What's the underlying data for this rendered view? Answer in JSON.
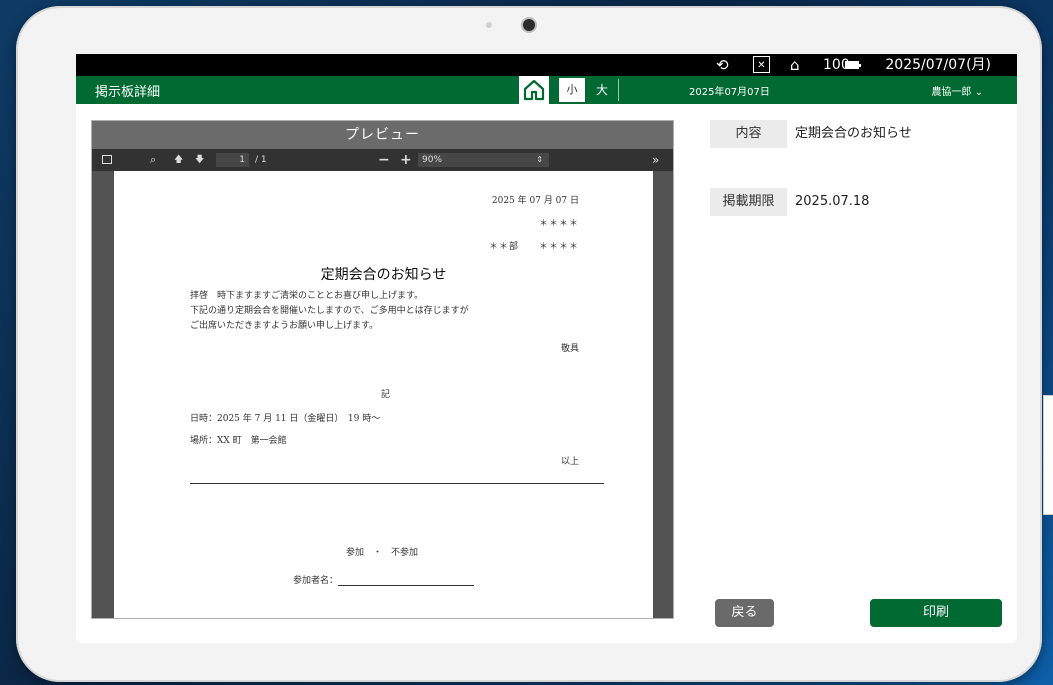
{
  "status_bar": {
    "rotate_icon": "screen-rotation-icon",
    "expand_icon": "expand-icon",
    "home_icon": "home-outline-icon",
    "battery_text": "100",
    "date": "2025/07/07(月)"
  },
  "app_bar": {
    "title": "掲示板詳細",
    "home_icon": "home-icon",
    "font_small": "小",
    "font_large": "大",
    "date": "2025年07月07日",
    "user": "農協一郎 ⌄"
  },
  "preview": {
    "title": "プレビュー",
    "toolbar": {
      "page_current": "1",
      "page_total": "/ 1",
      "zoom": "90%"
    },
    "document": {
      "date": "2025 年 07 月 07 日",
      "sender_name": "＊＊＊＊",
      "department": "＊＊部　　＊＊＊＊",
      "title": "定期会合のお知らせ",
      "body_lines": [
        "拝啓　時下ますますご清栄のこととお喜び申し上げます。",
        "下記の通り定期会合を開催いたしますので、ご多用中とは存じますが",
        "ご出席いただきますようお願い申し上げます。"
      ],
      "closing": "敬具",
      "ki": "記",
      "datetime": "日時：2025 年 7 月 11 日（金曜日）　19 時～",
      "place": "場所：XX 町　第一会館",
      "ijou": "以上",
      "attendance": "参加　・　不参加",
      "name_label": "参加者名："
    }
  },
  "details": {
    "content_label": "内容",
    "content_value": "定期会合のお知らせ",
    "deadline_label": "掲載期限",
    "deadline_value": "2025.07.18"
  },
  "actions": {
    "back": "戻る",
    "print": "印刷"
  },
  "colors": {
    "brand_green": "#006a32",
    "back_button": "#6a6a6a"
  }
}
